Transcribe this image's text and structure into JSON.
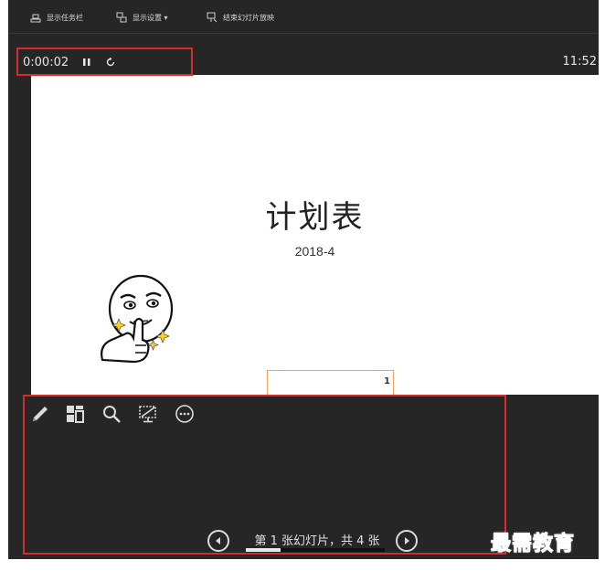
{
  "toolbar": {
    "show_taskbar": "显示任务栏",
    "display_settings": "显示设置 ▾",
    "end_slideshow": "结束幻灯片放映"
  },
  "timer": {
    "elapsed": "0:00:02",
    "pause_icon": "pause-icon",
    "restart_icon": "restart-icon"
  },
  "clock": "11:52",
  "slide": {
    "title": "计划表",
    "subtitle": "2018-4",
    "slide_number": "1"
  },
  "tools": [
    "pen-icon",
    "see-all-slides-icon",
    "zoom-icon",
    "black-screen-icon",
    "more-options-icon"
  ],
  "navigation": {
    "label": "第 1 张幻灯片，共 4 张",
    "current": 1,
    "total": 4,
    "progress": 0.25
  },
  "watermark": "最需教育",
  "colors": {
    "background": "#262626",
    "highlight_box": "#d62b2b",
    "watermark": "#2a3bd6"
  }
}
